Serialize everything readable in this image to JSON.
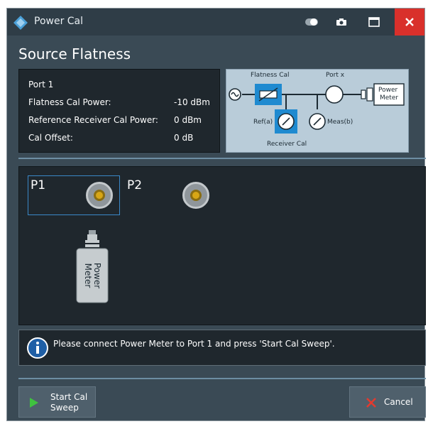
{
  "window": {
    "title": "Power Cal"
  },
  "titlebar": {
    "icons": [
      "toggle-icon",
      "camera-icon",
      "maximize-icon",
      "close-icon"
    ]
  },
  "page": {
    "heading": "Source Flatness"
  },
  "info": {
    "port": "Port 1",
    "rows": [
      {
        "label": "Flatness Cal Power:",
        "value": "-10 dBm"
      },
      {
        "label": "Reference Receiver Cal Power:",
        "value": "0 dBm"
      },
      {
        "label": "Cal Offset:",
        "value": "0 dB"
      }
    ]
  },
  "diagram": {
    "flatness_cal": "Flatness Cal",
    "port_x": "Port x",
    "power_meter_line1": "Power",
    "power_meter_line2": "Meter",
    "ref": "Ref(a)",
    "meas": "Meas(b)",
    "receiver_cal": "Receiver Cal"
  },
  "ports": {
    "p1": "P1",
    "p2": "P2",
    "power_meter_line1": "Power",
    "power_meter_line2": "Meter"
  },
  "message": {
    "text": "Please connect Power Meter to Port 1 and press 'Start Cal Sweep'."
  },
  "buttons": {
    "start_line1": "Start Cal",
    "start_line2": "Sweep",
    "cancel": "Cancel"
  },
  "colors": {
    "close": "#d9302b",
    "play": "#3fc23f",
    "cancel_x": "#e23a2f",
    "connector": "#d7a616"
  }
}
